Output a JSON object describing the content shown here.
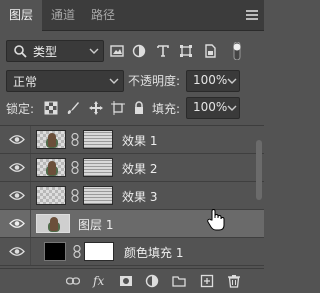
{
  "tabs": [
    {
      "label": "图层",
      "active": true
    },
    {
      "label": "通道",
      "active": false
    },
    {
      "label": "路径",
      "active": false
    }
  ],
  "filter": {
    "kind_label": "类型",
    "icons": [
      "image-filter-icon",
      "adjustment-filter-icon",
      "type-filter-icon",
      "shape-filter-icon",
      "smart-object-filter-icon",
      "filter-toggle-icon"
    ]
  },
  "blend": {
    "mode": "正常",
    "opacity_label": "不透明度:",
    "opacity_value": "100%"
  },
  "lock": {
    "label": "锁定:",
    "fill_label": "填充:",
    "fill_value": "100%"
  },
  "layers": [
    {
      "name": "效果 1",
      "selected": false,
      "type": "effect"
    },
    {
      "name": "效果 2",
      "selected": false,
      "type": "effect"
    },
    {
      "name": "效果 3",
      "selected": false,
      "type": "effect"
    },
    {
      "name": "图层 1",
      "selected": true,
      "type": "image"
    },
    {
      "name": "颜色填充 1",
      "selected": false,
      "type": "fill"
    }
  ],
  "bottom_icons": [
    "link-layers-icon",
    "fx-icon",
    "add-mask-icon",
    "adjustment-layer-icon",
    "group-folder-icon",
    "new-layer-icon",
    "trash-icon"
  ],
  "colors": {
    "panel_bg": "#535353",
    "tab_bg": "#3c3c3c",
    "selected_bg": "#6a6a6a",
    "field_bg": "#3a3a3a"
  }
}
